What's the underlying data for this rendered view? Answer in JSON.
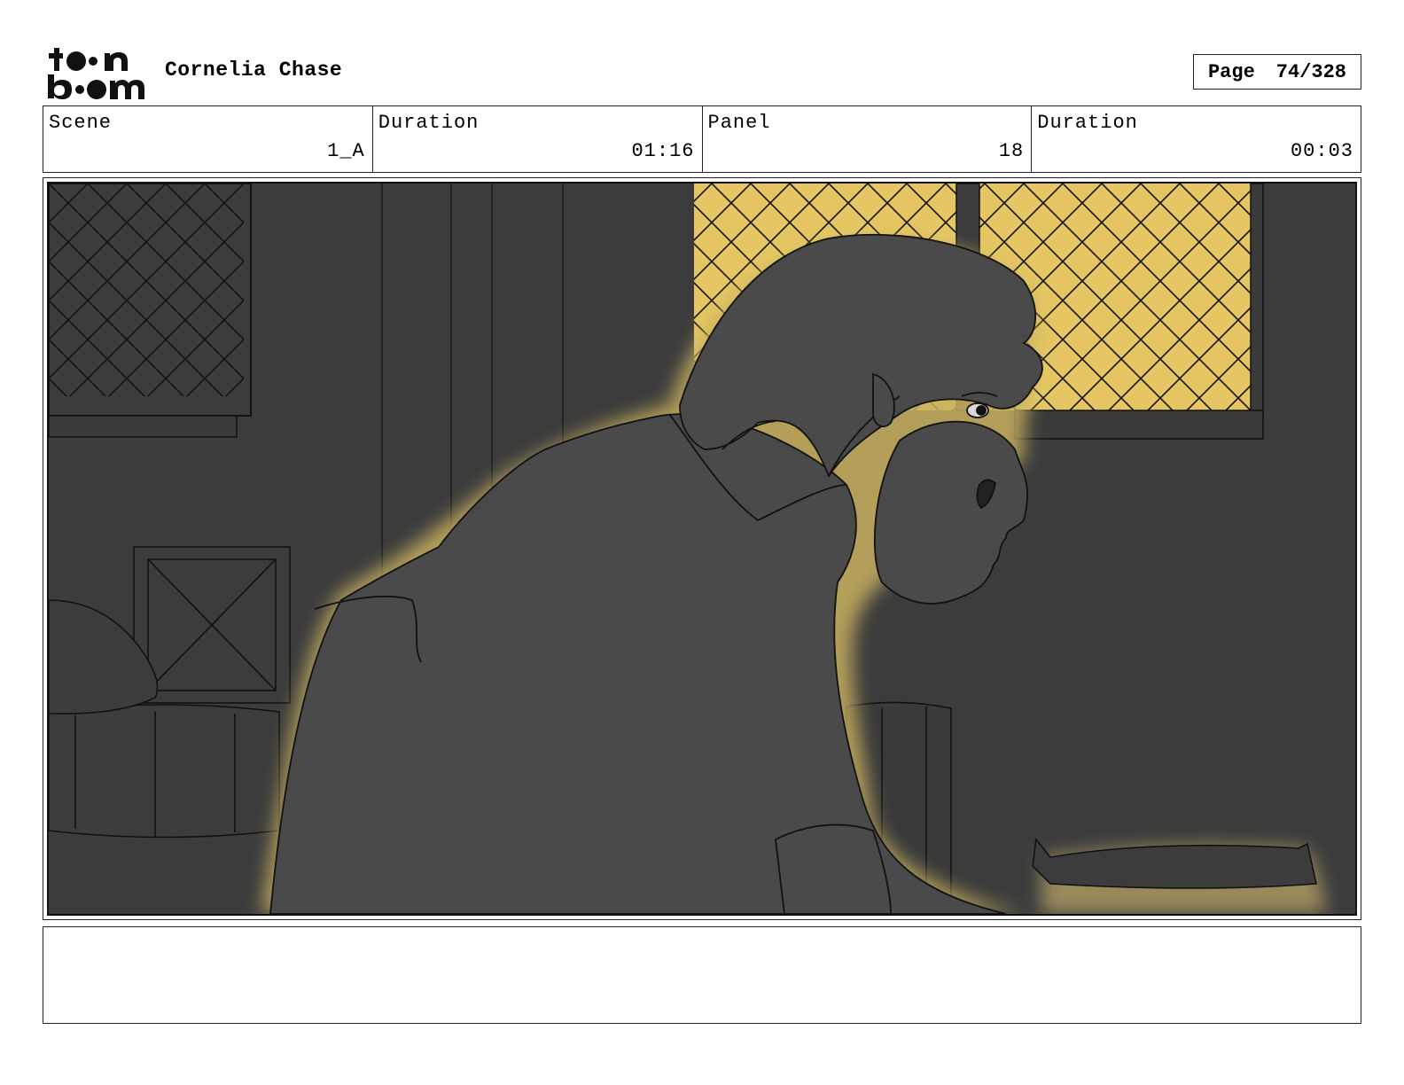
{
  "header": {
    "logo_text": "toon boom",
    "project_title": "Cornelia Chase",
    "page_label": "Page",
    "page_number": "74/328"
  },
  "info": {
    "scene_label": "Scene",
    "scene_value": "1_A",
    "scene_duration_label": "Duration",
    "scene_duration_value": "01:16",
    "panel_label": "Panel",
    "panel_value": "18",
    "panel_duration_label": "Duration",
    "panel_duration_value": "00:03"
  },
  "panel": {
    "colors": {
      "background": "#3c3c3c",
      "window_light": "#e5c662",
      "figure": "#4a4a4a",
      "glow": "#c8b060"
    }
  },
  "caption": {
    "text": ""
  }
}
